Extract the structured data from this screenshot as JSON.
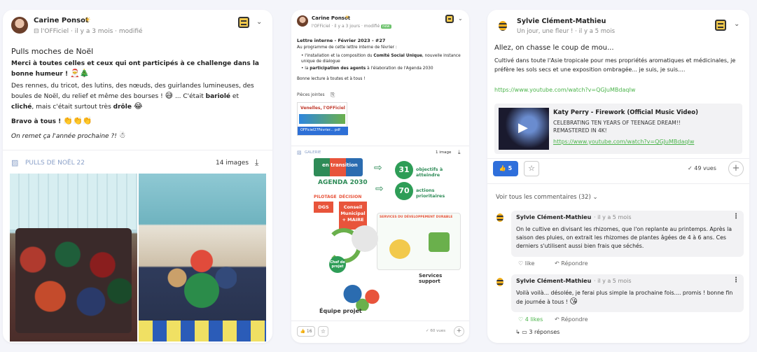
{
  "post1": {
    "author": "Carine Ponsot",
    "community": "l'OFFiciel",
    "time": "il y a 3 mois",
    "edited": "modifié",
    "title": "Pulls moches de Noël",
    "p1_bold": "Merci à toutes celles et ceux qui ont participés à ce challenge dans la bonne humeur !",
    "p2": "Des rennes, du tricot, des lutins, des nœuds, des guirlandes lumineuses, des boules de Noël, du relief et même des bourses !",
    "p2b": "... C'était",
    "p2_bariole": "bariolé",
    "p2_et": "et",
    "p2_cliche": "cliché",
    "p2c": ", mais c'était surtout très",
    "p2_drole": "drôle",
    "bravo": "Bravo à tous !",
    "closing": "On remet ça l'année prochaine ?!",
    "gallery_label": "PULLS DE NOËL 22",
    "gallery_count": "14 images"
  },
  "post2": {
    "author": "Carine Ponsot",
    "community": "l'OFFiciel",
    "time": "il y a 3 jours",
    "edited": "modifié",
    "badge": "new",
    "title": "Lettre interne - Février 2023 - #27",
    "intro": "Au programme de cette lettre interne de février :",
    "bullet1_a": "l'installation et la composition du",
    "bullet1_b": "Comité Social Unique",
    "bullet1_c": ", nouvelle instance unique de dialogue",
    "bullet2_a": "la",
    "bullet2_b": "participation des agents",
    "bullet2_c": "à l'élaboration de l'Agenda 2030",
    "outro": "Bonne lecture à toutes et à tous !",
    "attachments_label": "Pièces jointes",
    "attachment_title": "Venelles, l'OFFiciel",
    "attachment_file": "OFFiciel27Février... pdf",
    "gallery_label": "GALERIE",
    "gallery_count": "1 image",
    "poster": {
      "heading1": "en transition",
      "agenda": "AGENDA 2030",
      "num31": "31",
      "num31_text": "objectifs à atteindre",
      "num70": "70",
      "num70_text": "actions prioritaires",
      "pilotage": "PILOTAGE",
      "dgs": "DGS",
      "decision": "DÉCISION",
      "conseil": "Conseil Municipal + MAIRE",
      "services_dev": "SERVICES DU DÉVELOPPEMENT DURABLE",
      "chef": "Chef de projet",
      "services_support": "Services support",
      "equipe": "Équipe projet"
    },
    "likes": "16",
    "views": "60 vues"
  },
  "post3": {
    "author": "Sylvie Clément-Mathieu",
    "community": "Un jour, une fleur !",
    "time": "il y a 5 mois",
    "title": "Allez, on chasse le coup de mou...",
    "body": "Cultivé dans toute l'Asie tropicale pour mes propriétés aromatiques et médicinales, je préfère les sols secs et une exposition ombragée... je suis, je suis....",
    "link": "https://www.youtube.com/watch?v=QGJuMBdaqIw",
    "video_title": "Katy Perry - Firework (Official Music Video)",
    "video_desc": "CELEBRATING TEN YEARS OF TEENAGE DREAM!! REMASTERED IN 4K!",
    "video_link": "https://www.youtube.com/watch?v=QGJuMBdaqIw",
    "likes": "5",
    "views": "49 vues",
    "see_comments": "Voir tous les commentaires (32)",
    "comments": [
      {
        "author": "Sylvie Clément-Mathieu",
        "time": "il y a 5 mois",
        "text": "On le cultive en divisant les rhizomes, que l'on replante au printemps. Après la saison des pluies, on extrait les rhizomes de plantes âgées de 4 à 6 ans. Ces derniers s'utilisent aussi bien frais que séchés.",
        "like": "like",
        "reply": "Répondre"
      },
      {
        "author": "Sylvie Clément-Mathieu",
        "time": "il y a 5 mois",
        "text": "Voilà voilà... désolée, je ferai plus simple la prochaine fois.... promis ! bonne fin de journée à tous !",
        "like": "4 likes",
        "reply": "Répondre",
        "replies": "3 réponses"
      }
    ]
  },
  "sep": "·"
}
